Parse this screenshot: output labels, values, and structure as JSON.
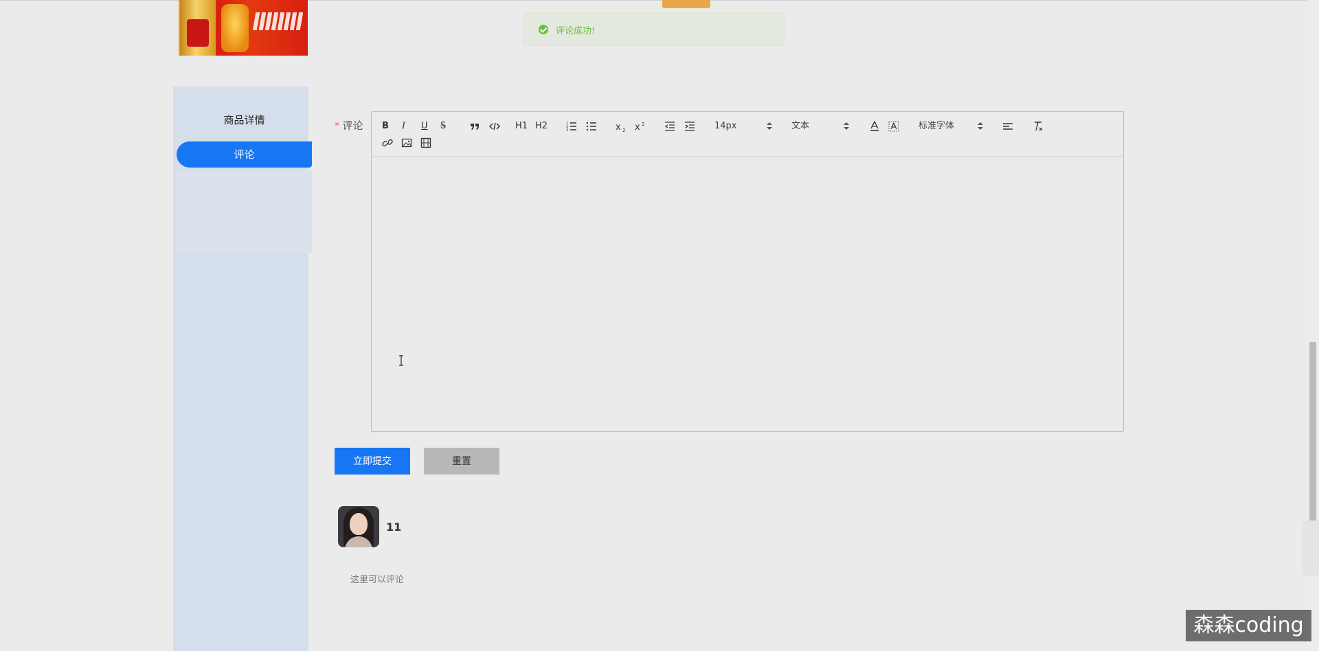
{
  "toast": {
    "message": "评论成功!"
  },
  "sidebar": {
    "items": [
      {
        "label": "商品详情",
        "active": false
      },
      {
        "label": "评论",
        "active": true
      }
    ]
  },
  "form": {
    "label": "评论",
    "required_mark": "*",
    "editor": {
      "toolbar": {
        "bold": "B",
        "italic": "I",
        "underline": "U",
        "strike": "S",
        "h1": "H1",
        "h2": "H2",
        "size": "14px",
        "header": "文本",
        "font": "标准字体"
      },
      "content": ""
    },
    "submit_label": "立即提交",
    "reset_label": "重置"
  },
  "comments": [
    {
      "user": "11",
      "text": "这里可以评论"
    }
  ],
  "watermark": "森森coding",
  "colors": {
    "primary": "#1777f2",
    "success": "#67c23a",
    "sidebar_bg": "#d5deeb"
  }
}
